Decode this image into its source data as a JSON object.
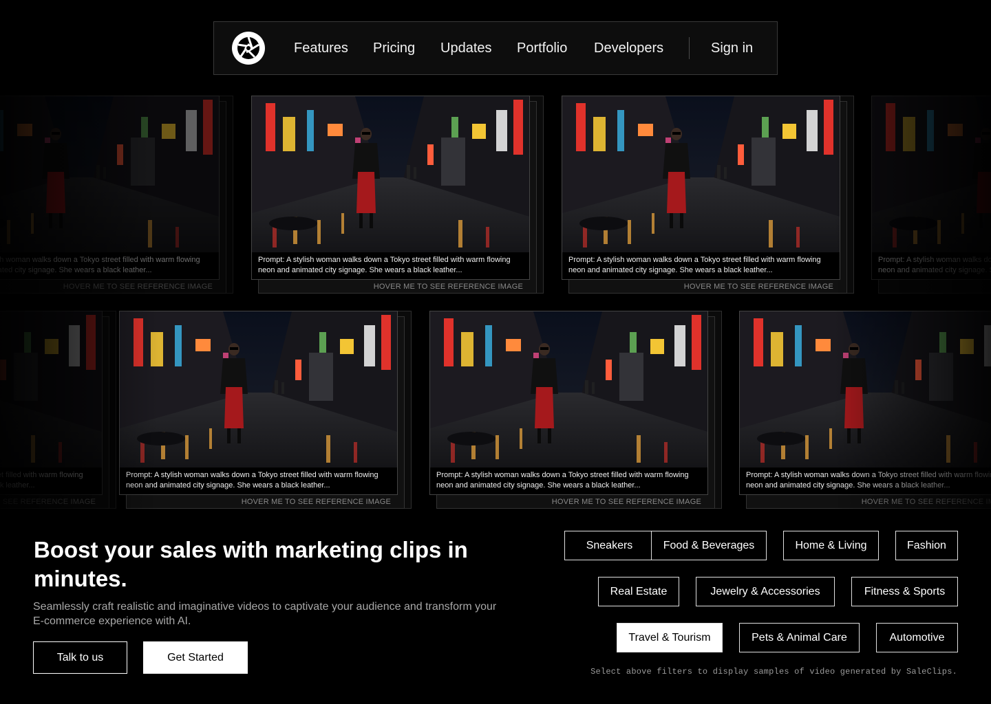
{
  "nav": {
    "logo": "aperture-logo-icon",
    "links": [
      "Features",
      "Pricing",
      "Updates",
      "Portfolio",
      "Developers"
    ],
    "sign_in": "Sign in"
  },
  "gallery": {
    "prompt": "Prompt: A stylish woman walks down a Tokyo street filled with warm flowing neon and animated city signage. She wears a black leather...",
    "hover_label": "HOVER ME TO SEE REFERENCE IMAGE"
  },
  "hero": {
    "title": "Boost your sales with marketing clips in minutes.",
    "subtitle": "Seamlessly craft realistic and imaginative videos to captivate your audience and transform your E-commerce experience with AI.",
    "talk_button": "Talk to us",
    "start_button": "Get Started"
  },
  "filters": {
    "row1": [
      "Sneakers",
      "Food & Beverages",
      "Home & Living",
      "Fashion"
    ],
    "row2": [
      "Real Estate",
      "Jewelry & Accessories",
      "Fitness & Sports"
    ],
    "row3": [
      "Travel & Tourism",
      "Pets & Animal Care",
      "Automotive"
    ],
    "active": "Travel & Tourism",
    "note": "Select above filters to display samples of video generated by SaleClips."
  },
  "colors": {
    "background": "#000000",
    "accent": "#ffffff",
    "neon_red": "#e0322b",
    "neon_yellow": "#f3c534"
  }
}
